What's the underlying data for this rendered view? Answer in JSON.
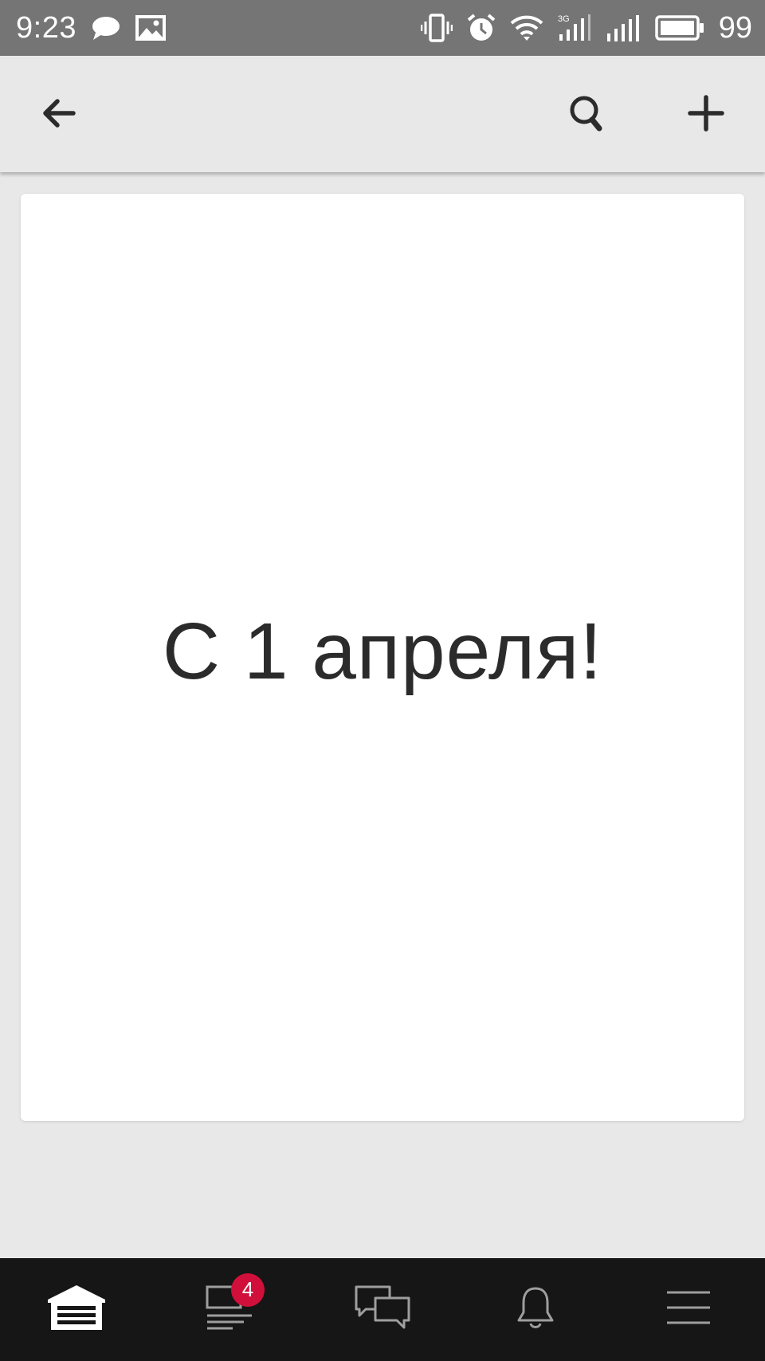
{
  "status_bar": {
    "time": "9:23",
    "battery_percent": "99",
    "icons": [
      "chat-bubble-icon",
      "image-icon",
      "vibrate-icon",
      "alarm-icon",
      "wifi-icon",
      "signal-3g-icon",
      "signal-icon",
      "battery-icon"
    ]
  },
  "toolbar": {
    "icons": [
      "back-arrow-icon",
      "search-icon",
      "plus-icon"
    ]
  },
  "card": {
    "text": "С 1 апреля!"
  },
  "bottom_nav": {
    "items": [
      {
        "icon": "garage-icon",
        "active": true
      },
      {
        "icon": "feed-icon",
        "badge": "4"
      },
      {
        "icon": "messages-icon"
      },
      {
        "icon": "bell-icon"
      },
      {
        "icon": "menu-icon"
      }
    ]
  },
  "colors": {
    "status_bar_bg": "#757575",
    "background": "#e8e8e8",
    "bottom_nav_bg": "#161616",
    "badge": "#d0103a",
    "text": "#2b2b2b"
  }
}
